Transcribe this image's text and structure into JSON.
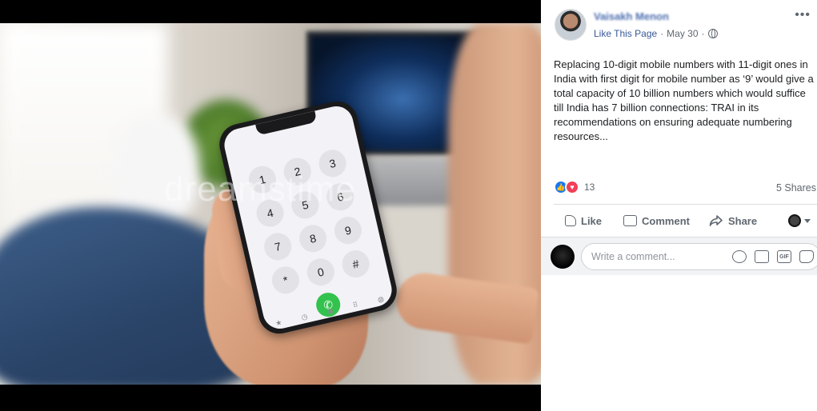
{
  "post": {
    "poster_name": "Vaisakh Menon",
    "like_page_label": "Like This Page",
    "separator": "·",
    "date": "May 30",
    "text": "Replacing 10-digit mobile numbers with 11-digit ones in India with first digit for mobile number as ‘9’ would give a total capacity of 10 billion numbers which would suffice till India has 7 billion connections: TRAI in its recommendations on ensuring adequate numbering resources...",
    "more_icon": "•••"
  },
  "photo": {
    "watermark": "dreamstime",
    "keypad": [
      "1",
      "2",
      "3",
      "4",
      "5",
      "6",
      "7",
      "8",
      "9",
      "*",
      "0",
      "#"
    ],
    "call_icon": "✆",
    "tabbar": [
      "★",
      "◷",
      "◉",
      "⠿",
      "◍"
    ]
  },
  "engagement": {
    "reaction_count": "13",
    "shares": "5 Shares",
    "like_react_icon": "👍",
    "love_react_icon": "♥"
  },
  "actions": {
    "like": "Like",
    "comment": "Comment",
    "share": "Share"
  },
  "comment": {
    "placeholder": "Write a comment...",
    "gif_label": "GIF"
  },
  "colors": {
    "link_blue": "#385898",
    "like_blue": "#1877f2",
    "love_red": "#f33e58",
    "muted_text": "#606770"
  }
}
